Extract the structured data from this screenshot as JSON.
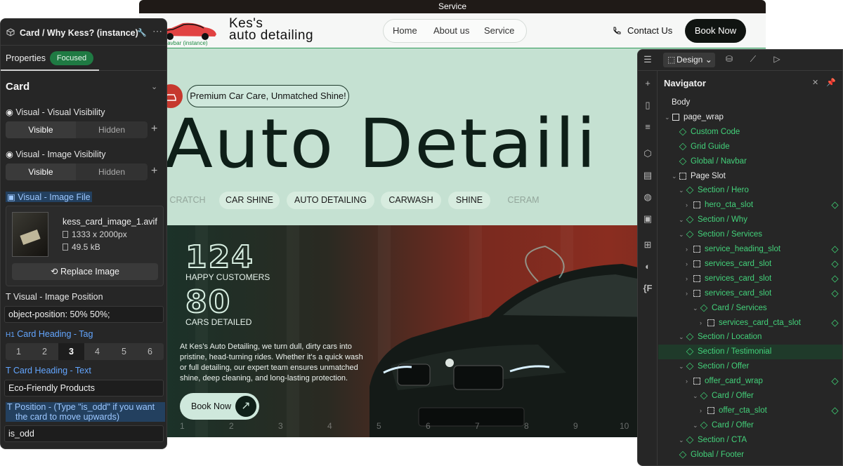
{
  "site": {
    "topbar_label": "Service",
    "logo_line1": "Kes's",
    "logo_line2": "auto detailing",
    "instance_label": "/ Navbar (instance)",
    "nav": [
      "Home",
      "About us",
      "Service"
    ],
    "contact": "Contact Us",
    "book_now_top": "Book Now",
    "hero_pill": "Premium Car Care, Unmatched Shine!",
    "hero_title": "Auto Detaili",
    "tags": [
      "CRATCH",
      "CAR SHINE",
      "AUTO DETAILING",
      "CARWASH",
      "SHINE",
      "CERAM"
    ],
    "stat1_num": "124",
    "stat1_label": "HAPPY CUSTOMERS",
    "stat2_num": "80",
    "stat2_label": "CARS DETAILED",
    "paragraph": "At Kes's Auto Detailing, we turn dull, dirty cars into pristine, head-turning rides. Whether it's a quick wash or full detailing, our expert team ensures unmatched shine, deep cleaning, and long-lasting protection.",
    "book_now_hero": "Book Now",
    "arrow": "↗",
    "grid_numbers": [
      "1",
      "2",
      "3",
      "4",
      "5",
      "6",
      "7",
      "8",
      "9",
      "10"
    ]
  },
  "left_panel": {
    "title": "Card / Why Kess? (instance)",
    "tab_properties": "Properties",
    "focused_badge": "Focused",
    "section": "Card",
    "visual_visibility_label": "Visual - Visual Visibility",
    "image_visibility_label": "Visual - Image Visibility",
    "visible": "Visible",
    "hidden": "Hidden",
    "image_file_label": "Visual - Image File",
    "file_name": "kess_card_image_1.avif",
    "file_dims": "1333 x 2000px",
    "file_size": "49.5 kB",
    "replace_image": "Replace Image",
    "image_position_label": "Visual - Image Position",
    "image_position_value": "object-position: 50% 50%;",
    "heading_tag_label": "Card Heading - Tag",
    "heading_tags": [
      "1",
      "2",
      "3",
      "4",
      "5",
      "6"
    ],
    "heading_tag_selected": "3",
    "heading_text_label": "Card Heading - Text",
    "heading_text_value": "Eco-Friendly Products",
    "position_label": "Position - (Type \"is_odd\" if you want the card to move upwards)",
    "position_value": "is_odd",
    "h1_prefix": "H1",
    "t_prefix": "T"
  },
  "right_panel": {
    "design_label": "Design",
    "navigator_title": "Navigator",
    "tree": [
      {
        "label": "Body",
        "icon": "none",
        "color": "w",
        "depth": 0,
        "caret": false
      },
      {
        "label": "page_wrap",
        "icon": "box",
        "color": "w",
        "depth": 0,
        "caret": true
      },
      {
        "label": "Custom Code",
        "icon": "comp",
        "color": "g",
        "depth": 1,
        "caret": false
      },
      {
        "label": "Grid Guide",
        "icon": "comp",
        "color": "g",
        "depth": 1,
        "caret": false
      },
      {
        "label": "Global / Navbar",
        "icon": "comp",
        "color": "g",
        "depth": 1,
        "caret": false
      },
      {
        "label": "Page Slot",
        "icon": "slot",
        "color": "w",
        "depth": 1,
        "caret": true
      },
      {
        "label": "Section / Hero",
        "icon": "comp",
        "color": "g",
        "depth": 2,
        "caret": true
      },
      {
        "label": "hero_cta_slot",
        "icon": "slot",
        "color": "g",
        "depth": 3,
        "caret": true,
        "dot": true
      },
      {
        "label": "Section / Why",
        "icon": "comp",
        "color": "g",
        "depth": 2,
        "caret": true
      },
      {
        "label": "Section / Services",
        "icon": "comp",
        "color": "g",
        "depth": 2,
        "caret": true
      },
      {
        "label": "service_heading_slot",
        "icon": "slot",
        "color": "g",
        "depth": 3,
        "caret": true,
        "dot": true
      },
      {
        "label": "services_card_slot",
        "icon": "slot",
        "color": "g",
        "depth": 3,
        "caret": true,
        "dot": true
      },
      {
        "label": "services_card_slot",
        "icon": "slot",
        "color": "g",
        "depth": 3,
        "caret": true,
        "dot": true
      },
      {
        "label": "services_card_slot",
        "icon": "slot",
        "color": "g",
        "depth": 3,
        "caret": true,
        "dot": true
      },
      {
        "label": "Card / Services",
        "icon": "comp",
        "color": "g",
        "depth": 4,
        "caret": true
      },
      {
        "label": "services_card_cta_slot",
        "icon": "slot",
        "color": "g",
        "depth": 5,
        "caret": true,
        "dot": true
      },
      {
        "label": "Section / Location",
        "icon": "comp",
        "color": "g",
        "depth": 2,
        "caret": true
      },
      {
        "label": "Section / Testimonial",
        "icon": "comp",
        "color": "g",
        "depth": 2,
        "caret": false,
        "selected": true
      },
      {
        "label": "Section / Offer",
        "icon": "comp",
        "color": "g",
        "depth": 2,
        "caret": true
      },
      {
        "label": "offer_card_wrap",
        "icon": "slot",
        "color": "g",
        "depth": 3,
        "caret": true,
        "dot": true
      },
      {
        "label": "Card / Offer",
        "icon": "comp",
        "color": "g",
        "depth": 4,
        "caret": true
      },
      {
        "label": "offer_cta_slot",
        "icon": "slot",
        "color": "g",
        "depth": 5,
        "caret": true,
        "dot": true
      },
      {
        "label": "Card / Offer",
        "icon": "comp",
        "color": "g",
        "depth": 4,
        "caret": true
      },
      {
        "label": "Section / CTA",
        "icon": "comp",
        "color": "g",
        "depth": 2,
        "caret": true
      },
      {
        "label": "Global / Footer",
        "icon": "comp",
        "color": "g",
        "depth": 1,
        "caret": false
      }
    ]
  }
}
